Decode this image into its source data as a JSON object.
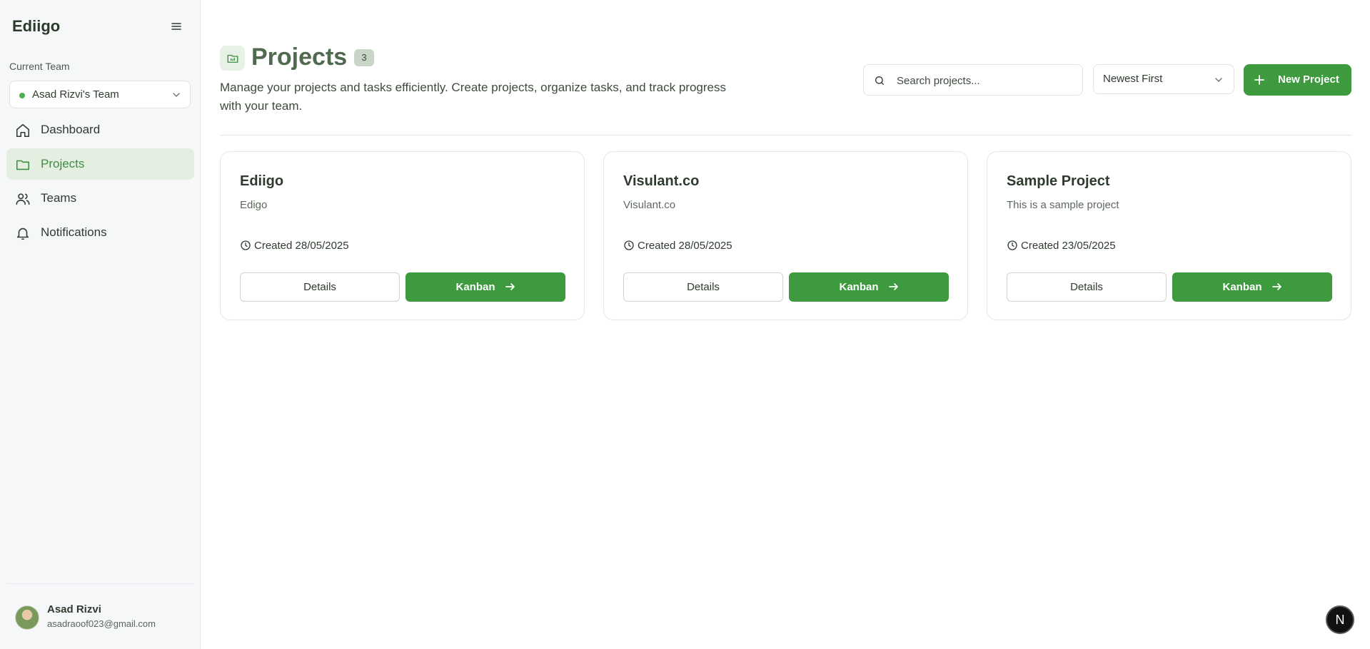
{
  "sidebar": {
    "brand": "Ediigo",
    "current_team_label": "Current Team",
    "team_name": "Asad Rizvi's Team",
    "nav": [
      {
        "label": "Dashboard",
        "icon": "home-icon"
      },
      {
        "label": "Projects",
        "icon": "folder-icon",
        "active": true
      },
      {
        "label": "Teams",
        "icon": "users-icon"
      },
      {
        "label": "Notifications",
        "icon": "bell-icon"
      }
    ],
    "user": {
      "name": "Asad Rizvi",
      "email": "asadraoof023@gmail.com"
    }
  },
  "header": {
    "title": "Projects",
    "count": "3",
    "description": "Manage your projects and tasks efficiently. Create projects, organize tasks, and track progress with your team.",
    "search_placeholder": "Search projects...",
    "sort_value": "Newest First",
    "new_button": "New Project"
  },
  "projects": [
    {
      "name": "Ediigo",
      "description": "Edigo",
      "created": "Created 28/05/2025",
      "details_label": "Details",
      "kanban_label": "Kanban"
    },
    {
      "name": "Visulant.co",
      "description": "Visulant.co",
      "created": "Created 28/05/2025",
      "details_label": "Details",
      "kanban_label": "Kanban"
    },
    {
      "name": "Sample Project",
      "description": "This is a sample project",
      "created": "Created 23/05/2025",
      "details_label": "Details",
      "kanban_label": "Kanban"
    }
  ],
  "floating_badge": "N",
  "colors": {
    "accent": "#3e9a3e",
    "active_nav_bg": "#e4efe1",
    "sidebar_bg": "#f6f7f9"
  }
}
